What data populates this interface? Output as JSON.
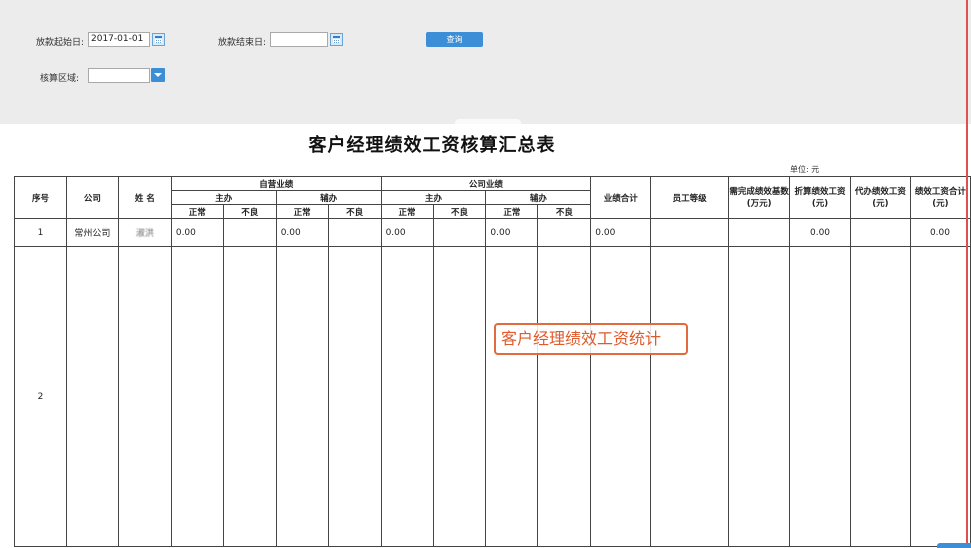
{
  "filters": {
    "start_date_label": "放款起始日:",
    "start_date_value": "2017-01-01",
    "end_date_label": "放款结束日:",
    "end_date_value": "",
    "query_label": "查询",
    "region_label": "核算区域:",
    "region_value": ""
  },
  "report": {
    "title": "客户经理绩效工资核算汇总表",
    "unit": "单位: 元"
  },
  "table": {
    "headers": {
      "seq": "序号",
      "company": "公司",
      "name": "姓 名",
      "self_business": "自营业绩",
      "company_business": "公司业绩",
      "main": "主办",
      "assist": "辅办",
      "normal": "正常",
      "bad": "不良",
      "total_performance": "业绩合计",
      "grade": "员工等级",
      "required_base": "需完成绩效基数(万元)",
      "converted_pay": "折算绩效工资(元)",
      "agency_pay": "代办绩效工资(元)",
      "total_pay": "绩效工资合计(元)"
    },
    "rows": [
      {
        "seq": "1",
        "company": "常州公司",
        "name": "淑洪",
        "self_main_normal": "0.00",
        "self_main_bad": "",
        "self_assist_normal": "0.00",
        "self_assist_bad": "",
        "co_main_normal": "0.00",
        "co_main_bad": "",
        "co_assist_normal": "0.00",
        "co_assist_bad": "",
        "total_performance": "0.00",
        "grade": "",
        "required_base": "",
        "converted_pay": "0.00",
        "agency_pay": "",
        "total_pay": "0.00"
      },
      {
        "seq": "2",
        "company": "",
        "name": "",
        "self_main_normal": "",
        "self_main_bad": "",
        "self_assist_normal": "",
        "self_assist_bad": "",
        "co_main_normal": "",
        "co_main_bad": "",
        "co_assist_normal": "",
        "co_assist_bad": "",
        "total_performance": "",
        "grade": "",
        "required_base": "",
        "converted_pay": "",
        "agency_pay": "",
        "total_pay": ""
      }
    ]
  },
  "annotation": "客户经理绩效工资统计",
  "colors": {
    "accent": "#3c8fd6",
    "callout": "#e26a3c",
    "panel": "#ececec"
  },
  "icons": {
    "calendar": "calendar-icon",
    "dropdown": "chevron-down-icon"
  }
}
